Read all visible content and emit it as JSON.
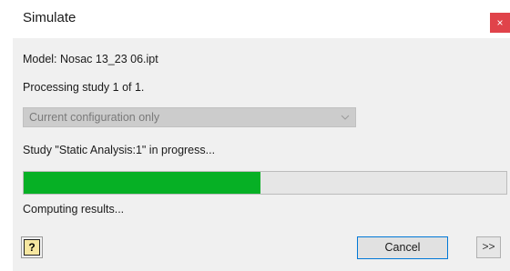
{
  "window": {
    "title": "Simulate",
    "close_label": "×"
  },
  "model_text": "Model: Nosac 13_23 06.ipt",
  "processing_text": "Processing study 1 of 1.",
  "configuration_select": {
    "value": "Current configuration only",
    "enabled": false
  },
  "study_status": "Study \"Static Analysis:1\" in progress...",
  "progress": {
    "percent": 49,
    "color": "#06b025"
  },
  "computing_text": "Computing results...",
  "buttons": {
    "help_label": "?",
    "cancel_label": "Cancel",
    "more_label": ">>"
  },
  "colors": {
    "close_button": "#e0434a",
    "cancel_border": "#0078d7"
  }
}
